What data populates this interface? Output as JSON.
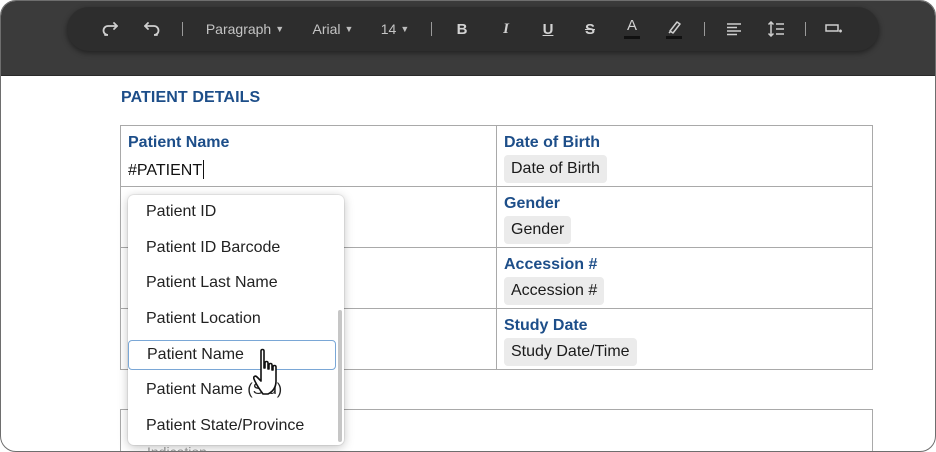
{
  "toolbar": {
    "redo_icon": "redo-icon",
    "undo_icon": "undo-icon",
    "block_format": "Paragraph",
    "font_family": "Arial",
    "font_size": "14",
    "bold_icon": "bold-icon",
    "italic_icon": "italic-icon",
    "underline_icon": "underline-icon",
    "strikethrough_icon": "strikethrough-icon",
    "text_color_icon": "font-color-icon",
    "highlight_icon": "highlighter-icon",
    "align_icon": "align-left-icon",
    "line_height_icon": "line-height-icon",
    "insert_field_icon": "insert-field-icon"
  },
  "document": {
    "section_title": "PATIENT DETAILS",
    "rows": [
      {
        "left_label": "Patient Name",
        "left_value": "#PATIENT",
        "right_label": "Date of Birth",
        "right_chip": "Date of Birth"
      },
      {
        "left_label": "",
        "left_value": "",
        "right_label": "Gender",
        "right_chip": "Gender"
      },
      {
        "left_label": "",
        "left_value": "",
        "right_label": "Accession #",
        "right_chip": "Accession #"
      },
      {
        "left_label": "",
        "left_value": "",
        "right_label": "Study Date",
        "right_chip": "Study Date/Time"
      }
    ],
    "partial_label": "Indication"
  },
  "autocomplete": {
    "items": [
      "Patient ID",
      "Patient ID Barcode",
      "Patient Last Name",
      "Patient Location",
      "Patient Name",
      "Patient Name (Std)",
      "Patient State/Province"
    ],
    "active_index": 4
  },
  "colors": {
    "label_blue": "#1d4e89",
    "toolbar_bg": "#2d2d2d",
    "topbar_bg": "#3b3b3b",
    "active_outline": "#7aa7d6"
  }
}
